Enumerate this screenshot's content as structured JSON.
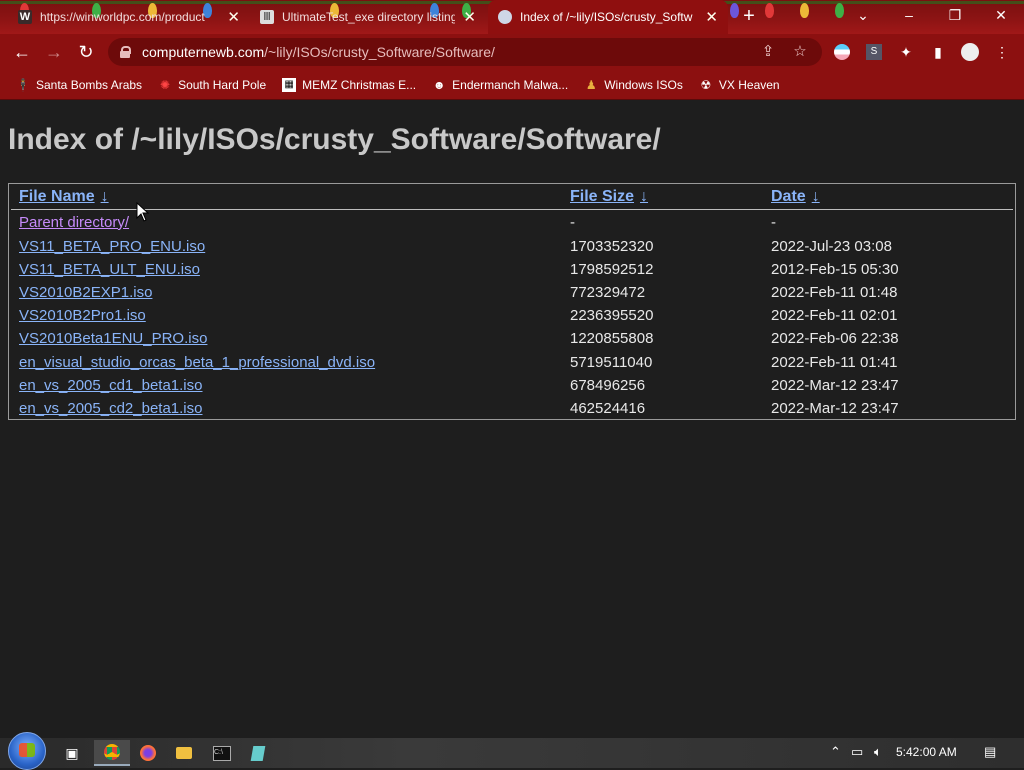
{
  "tabs": [
    {
      "title": "https://winworldpc.com/product",
      "favicon": "winworld-w-icon"
    },
    {
      "title": "UltimateTest_exe directory listing",
      "favicon": "archive-columns-icon"
    },
    {
      "title": "Index of /~lily/ISOs/crusty_Softw",
      "favicon": "computernewb-icon",
      "active": true
    }
  ],
  "window_controls": {
    "tab_search": "⌄",
    "minimize": "–",
    "restore": "❐",
    "close": "✕"
  },
  "omnibox": {
    "host": "computernewb.com",
    "path": "/~lily/ISOs/crusty_Software/Software/"
  },
  "bookmarks": [
    {
      "label": "Santa Bombs Arabs",
      "icon": "santa-icon"
    },
    {
      "label": "South Hard Pole",
      "icon": "snowflake-icon"
    },
    {
      "label": "MEMZ Christmas E...",
      "icon": "memz-icon"
    },
    {
      "label": "Endermanch Malwa...",
      "icon": "raccoon-icon"
    },
    {
      "label": "Windows ISOs",
      "icon": "buddha-icon"
    },
    {
      "label": "VX Heaven",
      "icon": "vx-icon"
    }
  ],
  "page": {
    "heading": "Index of /~lily/ISOs/crusty_Software/Software/",
    "columns": [
      {
        "label": "File Name",
        "sort": "↓"
      },
      {
        "label": "File Size",
        "sort": "↓"
      },
      {
        "label": "Date",
        "sort": "↓"
      }
    ],
    "rows": [
      {
        "name": "Parent directory/",
        "size": "-",
        "date": "-",
        "visited": true
      },
      {
        "name": "VS11_BETA_PRO_ENU.iso",
        "size": "1703352320",
        "date": "2022-Jul-23 03:08"
      },
      {
        "name": "VS11_BETA_ULT_ENU.iso",
        "size": "1798592512",
        "date": "2012-Feb-15 05:30"
      },
      {
        "name": "VS2010B2EXP1.iso",
        "size": "772329472",
        "date": "2022-Feb-11 01:48"
      },
      {
        "name": "VS2010B2Pro1.iso",
        "size": "2236395520",
        "date": "2022-Feb-11 02:01"
      },
      {
        "name": "VS2010Beta1ENU_PRO.iso",
        "size": "1220855808",
        "date": "2022-Feb-06 22:38"
      },
      {
        "name": "en_visual_studio_orcas_beta_1_professional_dvd.iso",
        "size": "5719511040",
        "date": "2022-Feb-11 01:41"
      },
      {
        "name": "en_vs_2005_cd1_beta1.iso",
        "size": "678496256",
        "date": "2022-Mar-12 23:47"
      },
      {
        "name": "en_vs_2005_cd2_beta1.iso",
        "size": "462524416",
        "date": "2022-Mar-12 23:47"
      }
    ]
  },
  "taskbar": {
    "apps": [
      "task-view-icon",
      "chrome-icon",
      "firefox-icon",
      "file-explorer-icon",
      "terminal-icon",
      "notepad-icon"
    ],
    "clock": "5:42:00 AM"
  },
  "colors": {
    "chrome_red": "#8c1010",
    "link": "#8ab4f8",
    "visited": "#c58af9",
    "page_bg": "#1e1e1e"
  }
}
